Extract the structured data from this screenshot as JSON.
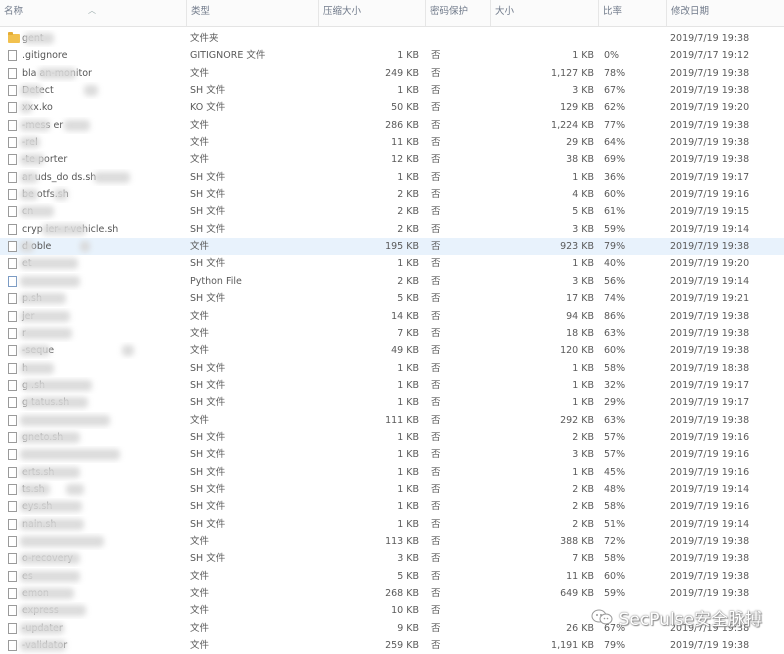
{
  "header": {
    "name": "名称",
    "type": "类型",
    "compressed_size": "压缩大小",
    "password_protected": "密码保护",
    "size": "大小",
    "ratio": "比率",
    "modified": "修改日期"
  },
  "rows": [
    {
      "name": "gent",
      "icon": "folder",
      "type": "文件夹",
      "csize": "",
      "prot": "",
      "size": "",
      "ratio": "",
      "date": "2019/7/19 19:38"
    },
    {
      "name": ".gitignore",
      "icon": "file",
      "type": "GITIGNORE 文件",
      "csize": "1 KB",
      "prot": "否",
      "size": "1 KB",
      "ratio": "0%",
      "date": "2019/7/17 19:12"
    },
    {
      "name": "bla      an-monitor",
      "icon": "file",
      "type": "文件",
      "csize": "249 KB",
      "prot": "否",
      "size": "1,127 KB",
      "ratio": "78%",
      "date": "2019/7/19 19:38"
    },
    {
      "name": "  Detect",
      "icon": "file",
      "type": "SH 文件",
      "csize": "1 KB",
      "prot": "否",
      "size": "3 KB",
      "ratio": "67%",
      "date": "2019/7/19 19:38"
    },
    {
      "name": "xxx.ko",
      "icon": "file",
      "type": "KO 文件",
      "csize": "50 KB",
      "prot": "否",
      "size": "129 KB",
      "ratio": "62%",
      "date": "2019/7/19 19:20"
    },
    {
      "name": "   -mess      er",
      "icon": "file",
      "type": "文件",
      "csize": "286 KB",
      "prot": "否",
      "size": "1,224 KB",
      "ratio": "77%",
      "date": "2019/7/19 19:38"
    },
    {
      "name": "   -rel",
      "icon": "file",
      "type": "文件",
      "csize": "11 KB",
      "prot": "否",
      "size": "29 KB",
      "ratio": "64%",
      "date": "2019/7/19 19:38"
    },
    {
      "name": "   -te     porter",
      "icon": "file",
      "type": "文件",
      "csize": "12 KB",
      "prot": "否",
      "size": "38 KB",
      "ratio": "69%",
      "date": "2019/7/19 19:38"
    },
    {
      "name": "   ar    uds_do       ds.sh",
      "icon": "file",
      "type": "SH 文件",
      "csize": "1 KB",
      "prot": "否",
      "size": "1 KB",
      "ratio": "36%",
      "date": "2019/7/19 19:17"
    },
    {
      "name": "   be     otfs.sh",
      "icon": "file",
      "type": "SH 文件",
      "csize": "2 KB",
      "prot": "否",
      "size": "4 KB",
      "ratio": "60%",
      "date": "2019/7/19 19:16"
    },
    {
      "name": "   cn",
      "icon": "file",
      "type": "SH 文件",
      "csize": "2 KB",
      "prot": "否",
      "size": "5 KB",
      "ratio": "61%",
      "date": "2019/7/19 19:15"
    },
    {
      "name": "cryp       ier-     r-vehicle.sh",
      "icon": "file",
      "type": "SH 文件",
      "csize": "2 KB",
      "prot": "否",
      "size": "3 KB",
      "ratio": "59%",
      "date": "2019/7/19 19:14"
    },
    {
      "name": "  d      oble",
      "icon": "file",
      "type": "文件",
      "csize": "195 KB",
      "prot": "否",
      "size": "923 KB",
      "ratio": "79%",
      "date": "2019/7/19 19:38",
      "selected": true
    },
    {
      "name": "        et",
      "icon": "file",
      "type": "SH 文件",
      "csize": "1 KB",
      "prot": "否",
      "size": "1 KB",
      "ratio": "40%",
      "date": "2019/7/19 19:20"
    },
    {
      "name": "",
      "icon": "python",
      "type": "Python File",
      "csize": "2 KB",
      "prot": "否",
      "size": "3 KB",
      "ratio": "56%",
      "date": "2019/7/19 19:14"
    },
    {
      "name": "        p.sh",
      "icon": "file",
      "type": "SH 文件",
      "csize": "5 KB",
      "prot": "否",
      "size": "17 KB",
      "ratio": "74%",
      "date": "2019/7/19 19:21"
    },
    {
      "name": "        jer",
      "icon": "file",
      "type": "文件",
      "csize": "14 KB",
      "prot": "否",
      "size": "94 KB",
      "ratio": "86%",
      "date": "2019/7/19 19:38"
    },
    {
      "name": "        r",
      "icon": "file",
      "type": "文件",
      "csize": "7 KB",
      "prot": "否",
      "size": "18 KB",
      "ratio": "63%",
      "date": "2019/7/19 19:38"
    },
    {
      "name": "        -seque",
      "icon": "file",
      "type": "文件",
      "csize": "49 KB",
      "prot": "否",
      "size": "120 KB",
      "ratio": "60%",
      "date": "2019/7/19 19:38"
    },
    {
      "name": "        h",
      "icon": "file",
      "type": "SH 文件",
      "csize": "1 KB",
      "prot": "否",
      "size": "1 KB",
      "ratio": "58%",
      "date": "2019/7/19 18:38"
    },
    {
      "name": "g          .sh",
      "icon": "file",
      "type": "SH 文件",
      "csize": "1 KB",
      "prot": "否",
      "size": "1 KB",
      "ratio": "32%",
      "date": "2019/7/19 19:17"
    },
    {
      "name": "g          tatus.sh",
      "icon": "file",
      "type": "SH 文件",
      "csize": "1 KB",
      "prot": "否",
      "size": "1 KB",
      "ratio": "29%",
      "date": "2019/7/19 19:17"
    },
    {
      "name": "",
      "icon": "file",
      "type": "文件",
      "csize": "111 KB",
      "prot": "否",
      "size": "292 KB",
      "ratio": "63%",
      "date": "2019/7/19 19:38"
    },
    {
      "name": "        gneto.sh",
      "icon": "file",
      "type": "SH 文件",
      "csize": "1 KB",
      "prot": "否",
      "size": "2 KB",
      "ratio": "57%",
      "date": "2019/7/19 19:16"
    },
    {
      "name": "",
      "icon": "file",
      "type": "SH 文件",
      "csize": "1 KB",
      "prot": "否",
      "size": "3 KB",
      "ratio": "57%",
      "date": "2019/7/19 19:16"
    },
    {
      "name": "        erts.sh",
      "icon": "file",
      "type": "SH 文件",
      "csize": "1 KB",
      "prot": "否",
      "size": "1 KB",
      "ratio": "45%",
      "date": "2019/7/19 19:16"
    },
    {
      "name": "        ts.sh",
      "icon": "file",
      "type": "SH 文件",
      "csize": "1 KB",
      "prot": "否",
      "size": "2 KB",
      "ratio": "48%",
      "date": "2019/7/19 19:14"
    },
    {
      "name": "        eys.sh",
      "icon": "file",
      "type": "SH 文件",
      "csize": "1 KB",
      "prot": "否",
      "size": "2 KB",
      "ratio": "58%",
      "date": "2019/7/19 19:16"
    },
    {
      "name": "        nain.sh",
      "icon": "file",
      "type": "SH 文件",
      "csize": "1 KB",
      "prot": "否",
      "size": "2 KB",
      "ratio": "51%",
      "date": "2019/7/19 19:14"
    },
    {
      "name": "",
      "icon": "file",
      "type": "文件",
      "csize": "113 KB",
      "prot": "否",
      "size": "388 KB",
      "ratio": "72%",
      "date": "2019/7/19 19:38"
    },
    {
      "name": "        o-recovery",
      "icon": "file",
      "type": "SH 文件",
      "csize": "3 KB",
      "prot": "否",
      "size": "7 KB",
      "ratio": "58%",
      "date": "2019/7/19 19:38"
    },
    {
      "name": "        es",
      "icon": "file",
      "type": "文件",
      "csize": "5 KB",
      "prot": "否",
      "size": "11 KB",
      "ratio": "60%",
      "date": "2019/7/19 19:38"
    },
    {
      "name": "        emon",
      "icon": "file",
      "type": "文件",
      "csize": "268 KB",
      "prot": "否",
      "size": "649 KB",
      "ratio": "59%",
      "date": "2019/7/19 19:38"
    },
    {
      "name": "        express",
      "icon": "file",
      "type": "文件",
      "csize": "10 KB",
      "prot": "否",
      "size": "",
      "ratio": "",
      "date": ""
    },
    {
      "name": "        -updater",
      "icon": "file",
      "type": "文件",
      "csize": "9 KB",
      "prot": "否",
      "size": "26 KB",
      "ratio": "67%",
      "date": "2019/7/19 19:38"
    },
    {
      "name": "        -validator",
      "icon": "file",
      "type": "文件",
      "csize": "259 KB",
      "prot": "否",
      "size": "1,191 KB",
      "ratio": "79%",
      "date": "2019/7/19 19:38"
    }
  ],
  "watermark": "SecPulse安全脉搏",
  "colors": {
    "selected_row": "#e8f2fc",
    "header_text": "#707a8a",
    "folder": "#f2c14e"
  }
}
